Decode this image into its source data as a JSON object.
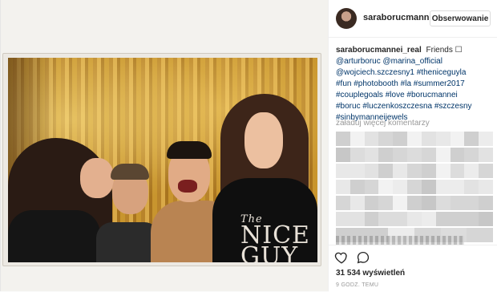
{
  "post": {
    "author": "saraborucmann",
    "follow_label": "Obserwowanie",
    "caption": {
      "author": "saraborucmannei_real",
      "text": "Friends ☐",
      "mentions": [
        "@arturboruc",
        "@marina_official",
        "@wojciech.szczesny1",
        "#theniceguyla"
      ],
      "hashtags": [
        "#fun",
        "#photobooth",
        "#la",
        "#summer2017",
        "#couplegoals",
        "#love",
        "#borucmannei",
        "#boruc",
        "#luczenkoszczesna",
        "#szczesny",
        "#sinbymanneijewels"
      ]
    },
    "load_more_label": "załaduj więcej komentarzy",
    "views": "31 534 wyświetleń",
    "timestamp": "9 GODZ. TEMU",
    "shirt_text_top": "The",
    "shirt_text_bottom": "NICE GUY"
  },
  "icons": {
    "like": "heart-icon",
    "comment": "comment-bubble-icon"
  },
  "colors": {
    "link": "#003569",
    "muted": "#999999",
    "border": "#dbdbdb"
  }
}
